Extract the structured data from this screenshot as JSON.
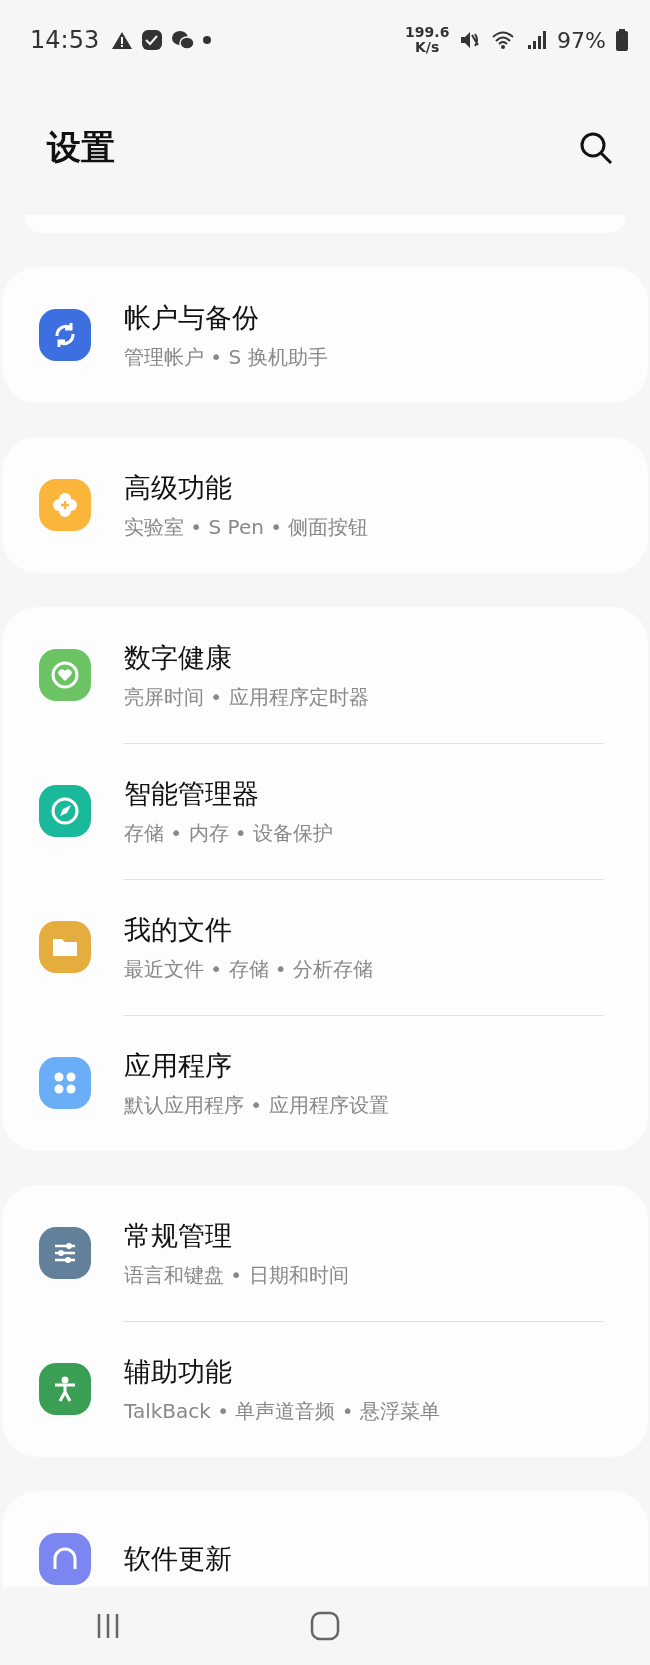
{
  "status_bar": {
    "time": "14:53",
    "speed_value": "199.6",
    "speed_unit": "K/s",
    "battery": "97%"
  },
  "header": {
    "title": "设置"
  },
  "sections": [
    {
      "kind": "sliver"
    },
    {
      "kind": "group",
      "items": [
        {
          "color": "#3e6fe0",
          "title": "帐户与备份",
          "subtitle": "管理帐户 • S 换机助手"
        }
      ]
    },
    {
      "kind": "group",
      "items": [
        {
          "color": "#fbb53a",
          "title": "高级功能",
          "subtitle": "实验室 • S Pen • 侧面按钮"
        }
      ]
    },
    {
      "kind": "group",
      "items": [
        {
          "color": "#6cc364",
          "title": "数字健康",
          "subtitle": "亮屏时间 • 应用程序定时器"
        },
        {
          "color": "#1ab99c",
          "title": "智能管理器",
          "subtitle": "存储 • 内存 • 设备保护"
        },
        {
          "color": "#e5ac3e",
          "title": "我的文件",
          "subtitle": "最近文件 • 存储 • 分析存储"
        },
        {
          "color": "#6aaef8",
          "title": "应用程序",
          "subtitle": "默认应用程序 • 应用程序设置"
        }
      ]
    },
    {
      "kind": "group",
      "items": [
        {
          "color": "#62809a",
          "title": "常规管理",
          "subtitle": "语言和键盘 • 日期和时间"
        },
        {
          "color": "#3a9f55",
          "title": "辅助功能",
          "subtitle": "TalkBack • 单声道音频 • 悬浮菜单"
        }
      ]
    },
    {
      "kind": "group",
      "items": [
        {
          "color": "#7b86f0",
          "title": "软件更新"
        }
      ]
    }
  ]
}
